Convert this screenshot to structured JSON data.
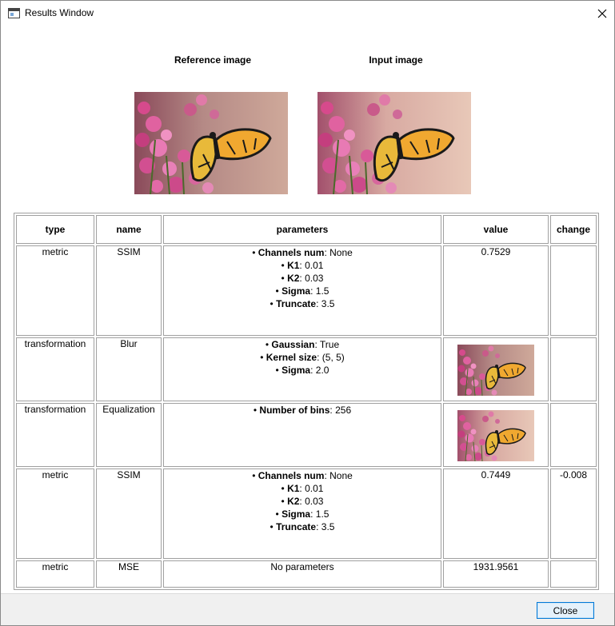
{
  "window": {
    "title": "Results Window"
  },
  "images": {
    "reference_label": "Reference image",
    "input_label": "Input image"
  },
  "table": {
    "headers": [
      "type",
      "name",
      "parameters",
      "value",
      "change"
    ],
    "rows": [
      {
        "type": "metric",
        "name": "SSIM",
        "params": [
          {
            "key": "Channels num",
            "val": "None"
          },
          {
            "key": "K1",
            "val": "0.01"
          },
          {
            "key": "K2",
            "val": "0.03"
          },
          {
            "key": "Sigma",
            "val": "1.5"
          },
          {
            "key": "Truncate",
            "val": "3.5"
          }
        ],
        "value": "0.7529",
        "change": ""
      },
      {
        "type": "transformation",
        "name": "Blur",
        "params": [
          {
            "key": "Gaussian",
            "val": "True"
          },
          {
            "key": "Kernel size",
            "val": "(5, 5)"
          },
          {
            "key": "Sigma",
            "val": "2.0"
          }
        ],
        "value": "",
        "change": ""
      },
      {
        "type": "transformation",
        "name": "Equalization",
        "params": [
          {
            "key": "Number of bins",
            "val": "256"
          }
        ],
        "value": "",
        "change": ""
      },
      {
        "type": "metric",
        "name": "SSIM",
        "params": [
          {
            "key": "Channels num",
            "val": "None"
          },
          {
            "key": "K1",
            "val": "0.01"
          },
          {
            "key": "K2",
            "val": "0.03"
          },
          {
            "key": "Sigma",
            "val": "1.5"
          },
          {
            "key": "Truncate",
            "val": "3.5"
          }
        ],
        "value": "0.7449",
        "change": "-0.008"
      },
      {
        "type": "metric",
        "name": "MSE",
        "no_params": "No parameters",
        "value": "1931.9561",
        "change": ""
      }
    ]
  },
  "footer": {
    "close_label": "Close"
  }
}
